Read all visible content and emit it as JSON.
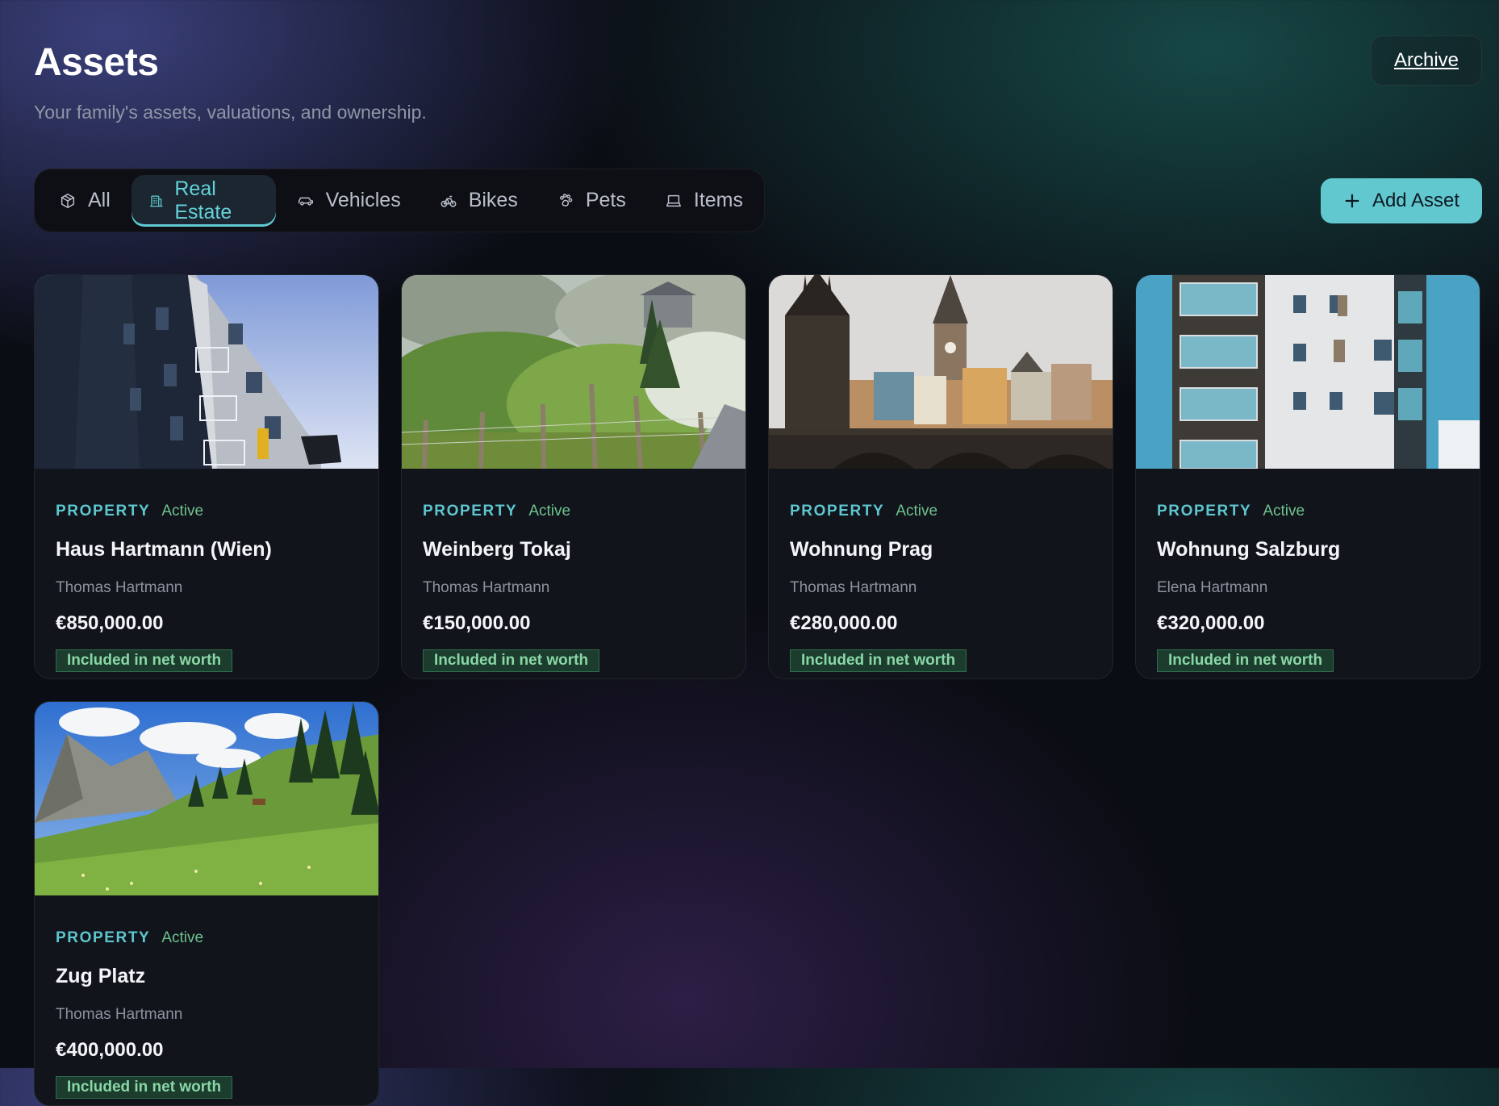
{
  "header": {
    "title": "Assets",
    "subtitle": "Your family's assets, valuations, and ownership.",
    "archive_label": "Archive"
  },
  "tabs": [
    {
      "label": "All",
      "icon": "box-icon",
      "active": false
    },
    {
      "label": "Real Estate",
      "icon": "building-icon",
      "active": true
    },
    {
      "label": "Vehicles",
      "icon": "car-icon",
      "active": false
    },
    {
      "label": "Bikes",
      "icon": "bike-icon",
      "active": false
    },
    {
      "label": "Pets",
      "icon": "paw-icon",
      "active": false
    },
    {
      "label": "Items",
      "icon": "laptop-icon",
      "active": false
    }
  ],
  "actions": {
    "add_label": "Add Asset",
    "add_icon": "plus-icon"
  },
  "assets": [
    {
      "type": "PROPERTY",
      "status": "Active",
      "name": "Haus Hartmann (Wien)",
      "owner": "Thomas Hartmann",
      "value": "€850,000.00",
      "badge": "Included in net worth",
      "image": "apartment-building-photo"
    },
    {
      "type": "PROPERTY",
      "status": "Active",
      "name": "Weinberg Tokaj",
      "owner": "Thomas Hartmann",
      "value": "€150,000.00",
      "badge": "Included in net worth",
      "image": "vineyard-photo"
    },
    {
      "type": "PROPERTY",
      "status": "Active",
      "name": "Wohnung Prag",
      "owner": "Thomas Hartmann",
      "value": "€280,000.00",
      "badge": "Included in net worth",
      "image": "prague-bridge-photo"
    },
    {
      "type": "PROPERTY",
      "status": "Active",
      "name": "Wohnung Salzburg",
      "owner": "Elena Hartmann",
      "value": "€320,000.00",
      "badge": "Included in net worth",
      "image": "modern-building-photo"
    },
    {
      "type": "PROPERTY",
      "status": "Active",
      "name": "Zug Platz",
      "owner": "Thomas Hartmann",
      "value": "€400,000.00",
      "badge": "Included in net worth",
      "image": "alpine-meadow-photo"
    }
  ],
  "colors": {
    "accent": "#62c8cf",
    "active_tab_text": "#63d2d9",
    "status_green": "#6ec28f",
    "badge_bg": "#1c3d2e",
    "badge_text": "#8ad7a6"
  }
}
